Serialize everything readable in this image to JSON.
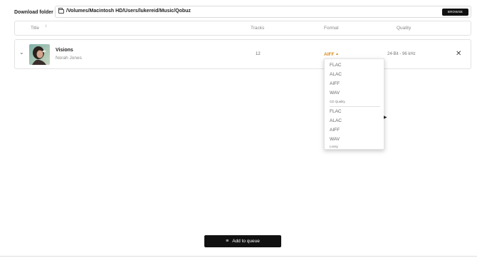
{
  "download": {
    "label": "Download folder",
    "path": "/Volumes/Macintosh HD/Users/lukereid/Music/Qobuz",
    "browse_label": "BROWSE"
  },
  "table": {
    "headers": {
      "title": "Title",
      "tracks": "Tracks",
      "format": "Format",
      "quality": "Quality"
    },
    "rows": [
      {
        "title": "Visions",
        "artist": "Norah Jones",
        "tracks": "12",
        "format": "AIFF",
        "quality": "24-Bit - 96 kHz"
      }
    ]
  },
  "dropdown": {
    "hires_items": [
      "FLAC",
      "ALAC",
      "AIFF",
      "WAV"
    ],
    "cd_group_label": "CD Quality",
    "cd_items": [
      "FLAC",
      "ALAC",
      "AIFF",
      "WAV"
    ],
    "lossy_group_label": "Lossy"
  },
  "footer": {
    "queue_label": "Add to queue"
  },
  "colors": {
    "accent": "#d98a1c",
    "button_bg": "#111111"
  }
}
